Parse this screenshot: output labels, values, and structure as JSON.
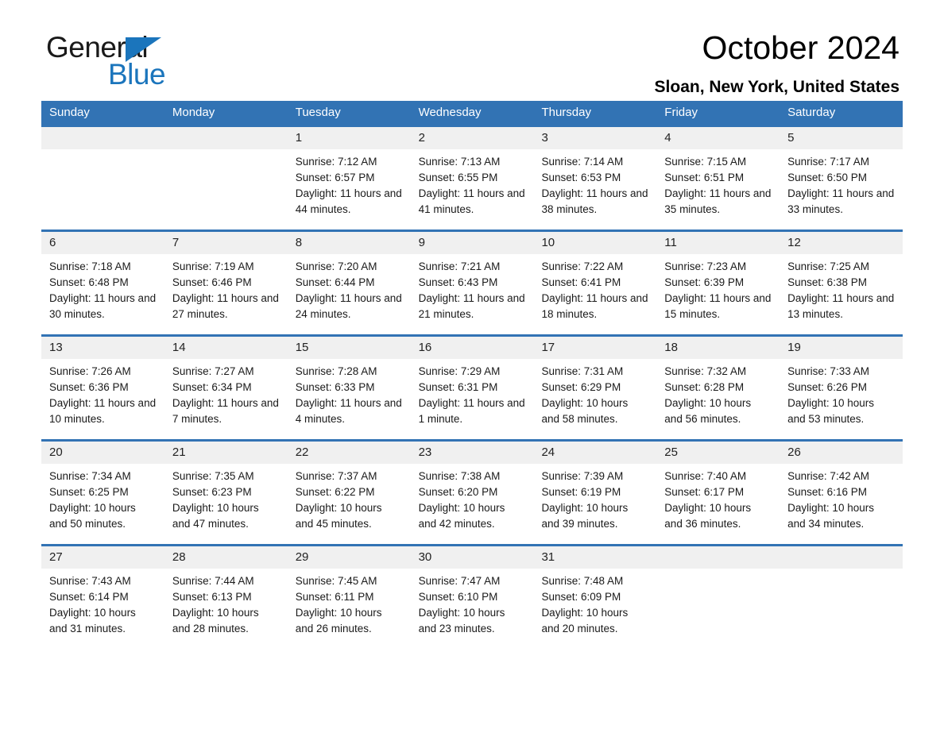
{
  "brand": {
    "name_dark": "General",
    "name_blue": "Blue",
    "accent_color": "#1b75bc"
  },
  "header": {
    "title": "October 2024",
    "location": "Sloan, New York, United States"
  },
  "calendar": {
    "header_bg": "#3273b4",
    "daynumber_bg": "#f0f0f0",
    "weekdays": [
      "Sunday",
      "Monday",
      "Tuesday",
      "Wednesday",
      "Thursday",
      "Friday",
      "Saturday"
    ],
    "weeks": [
      [
        {
          "date": "",
          "sunrise": "",
          "sunset": "",
          "daylight": ""
        },
        {
          "date": "",
          "sunrise": "",
          "sunset": "",
          "daylight": ""
        },
        {
          "date": "1",
          "sunrise": "Sunrise: 7:12 AM",
          "sunset": "Sunset: 6:57 PM",
          "daylight": "Daylight: 11 hours and 44 minutes."
        },
        {
          "date": "2",
          "sunrise": "Sunrise: 7:13 AM",
          "sunset": "Sunset: 6:55 PM",
          "daylight": "Daylight: 11 hours and 41 minutes."
        },
        {
          "date": "3",
          "sunrise": "Sunrise: 7:14 AM",
          "sunset": "Sunset: 6:53 PM",
          "daylight": "Daylight: 11 hours and 38 minutes."
        },
        {
          "date": "4",
          "sunrise": "Sunrise: 7:15 AM",
          "sunset": "Sunset: 6:51 PM",
          "daylight": "Daylight: 11 hours and 35 minutes."
        },
        {
          "date": "5",
          "sunrise": "Sunrise: 7:17 AM",
          "sunset": "Sunset: 6:50 PM",
          "daylight": "Daylight: 11 hours and 33 minutes."
        }
      ],
      [
        {
          "date": "6",
          "sunrise": "Sunrise: 7:18 AM",
          "sunset": "Sunset: 6:48 PM",
          "daylight": "Daylight: 11 hours and 30 minutes."
        },
        {
          "date": "7",
          "sunrise": "Sunrise: 7:19 AM",
          "sunset": "Sunset: 6:46 PM",
          "daylight": "Daylight: 11 hours and 27 minutes."
        },
        {
          "date": "8",
          "sunrise": "Sunrise: 7:20 AM",
          "sunset": "Sunset: 6:44 PM",
          "daylight": "Daylight: 11 hours and 24 minutes."
        },
        {
          "date": "9",
          "sunrise": "Sunrise: 7:21 AM",
          "sunset": "Sunset: 6:43 PM",
          "daylight": "Daylight: 11 hours and 21 minutes."
        },
        {
          "date": "10",
          "sunrise": "Sunrise: 7:22 AM",
          "sunset": "Sunset: 6:41 PM",
          "daylight": "Daylight: 11 hours and 18 minutes."
        },
        {
          "date": "11",
          "sunrise": "Sunrise: 7:23 AM",
          "sunset": "Sunset: 6:39 PM",
          "daylight": "Daylight: 11 hours and 15 minutes."
        },
        {
          "date": "12",
          "sunrise": "Sunrise: 7:25 AM",
          "sunset": "Sunset: 6:38 PM",
          "daylight": "Daylight: 11 hours and 13 minutes."
        }
      ],
      [
        {
          "date": "13",
          "sunrise": "Sunrise: 7:26 AM",
          "sunset": "Sunset: 6:36 PM",
          "daylight": "Daylight: 11 hours and 10 minutes."
        },
        {
          "date": "14",
          "sunrise": "Sunrise: 7:27 AM",
          "sunset": "Sunset: 6:34 PM",
          "daylight": "Daylight: 11 hours and 7 minutes."
        },
        {
          "date": "15",
          "sunrise": "Sunrise: 7:28 AM",
          "sunset": "Sunset: 6:33 PM",
          "daylight": "Daylight: 11 hours and 4 minutes."
        },
        {
          "date": "16",
          "sunrise": "Sunrise: 7:29 AM",
          "sunset": "Sunset: 6:31 PM",
          "daylight": "Daylight: 11 hours and 1 minute."
        },
        {
          "date": "17",
          "sunrise": "Sunrise: 7:31 AM",
          "sunset": "Sunset: 6:29 PM",
          "daylight": "Daylight: 10 hours and 58 minutes."
        },
        {
          "date": "18",
          "sunrise": "Sunrise: 7:32 AM",
          "sunset": "Sunset: 6:28 PM",
          "daylight": "Daylight: 10 hours and 56 minutes."
        },
        {
          "date": "19",
          "sunrise": "Sunrise: 7:33 AM",
          "sunset": "Sunset: 6:26 PM",
          "daylight": "Daylight: 10 hours and 53 minutes."
        }
      ],
      [
        {
          "date": "20",
          "sunrise": "Sunrise: 7:34 AM",
          "sunset": "Sunset: 6:25 PM",
          "daylight": "Daylight: 10 hours and 50 minutes."
        },
        {
          "date": "21",
          "sunrise": "Sunrise: 7:35 AM",
          "sunset": "Sunset: 6:23 PM",
          "daylight": "Daylight: 10 hours and 47 minutes."
        },
        {
          "date": "22",
          "sunrise": "Sunrise: 7:37 AM",
          "sunset": "Sunset: 6:22 PM",
          "daylight": "Daylight: 10 hours and 45 minutes."
        },
        {
          "date": "23",
          "sunrise": "Sunrise: 7:38 AM",
          "sunset": "Sunset: 6:20 PM",
          "daylight": "Daylight: 10 hours and 42 minutes."
        },
        {
          "date": "24",
          "sunrise": "Sunrise: 7:39 AM",
          "sunset": "Sunset: 6:19 PM",
          "daylight": "Daylight: 10 hours and 39 minutes."
        },
        {
          "date": "25",
          "sunrise": "Sunrise: 7:40 AM",
          "sunset": "Sunset: 6:17 PM",
          "daylight": "Daylight: 10 hours and 36 minutes."
        },
        {
          "date": "26",
          "sunrise": "Sunrise: 7:42 AM",
          "sunset": "Sunset: 6:16 PM",
          "daylight": "Daylight: 10 hours and 34 minutes."
        }
      ],
      [
        {
          "date": "27",
          "sunrise": "Sunrise: 7:43 AM",
          "sunset": "Sunset: 6:14 PM",
          "daylight": "Daylight: 10 hours and 31 minutes."
        },
        {
          "date": "28",
          "sunrise": "Sunrise: 7:44 AM",
          "sunset": "Sunset: 6:13 PM",
          "daylight": "Daylight: 10 hours and 28 minutes."
        },
        {
          "date": "29",
          "sunrise": "Sunrise: 7:45 AM",
          "sunset": "Sunset: 6:11 PM",
          "daylight": "Daylight: 10 hours and 26 minutes."
        },
        {
          "date": "30",
          "sunrise": "Sunrise: 7:47 AM",
          "sunset": "Sunset: 6:10 PM",
          "daylight": "Daylight: 10 hours and 23 minutes."
        },
        {
          "date": "31",
          "sunrise": "Sunrise: 7:48 AM",
          "sunset": "Sunset: 6:09 PM",
          "daylight": "Daylight: 10 hours and 20 minutes."
        },
        {
          "date": "",
          "sunrise": "",
          "sunset": "",
          "daylight": ""
        },
        {
          "date": "",
          "sunrise": "",
          "sunset": "",
          "daylight": ""
        }
      ]
    ]
  }
}
